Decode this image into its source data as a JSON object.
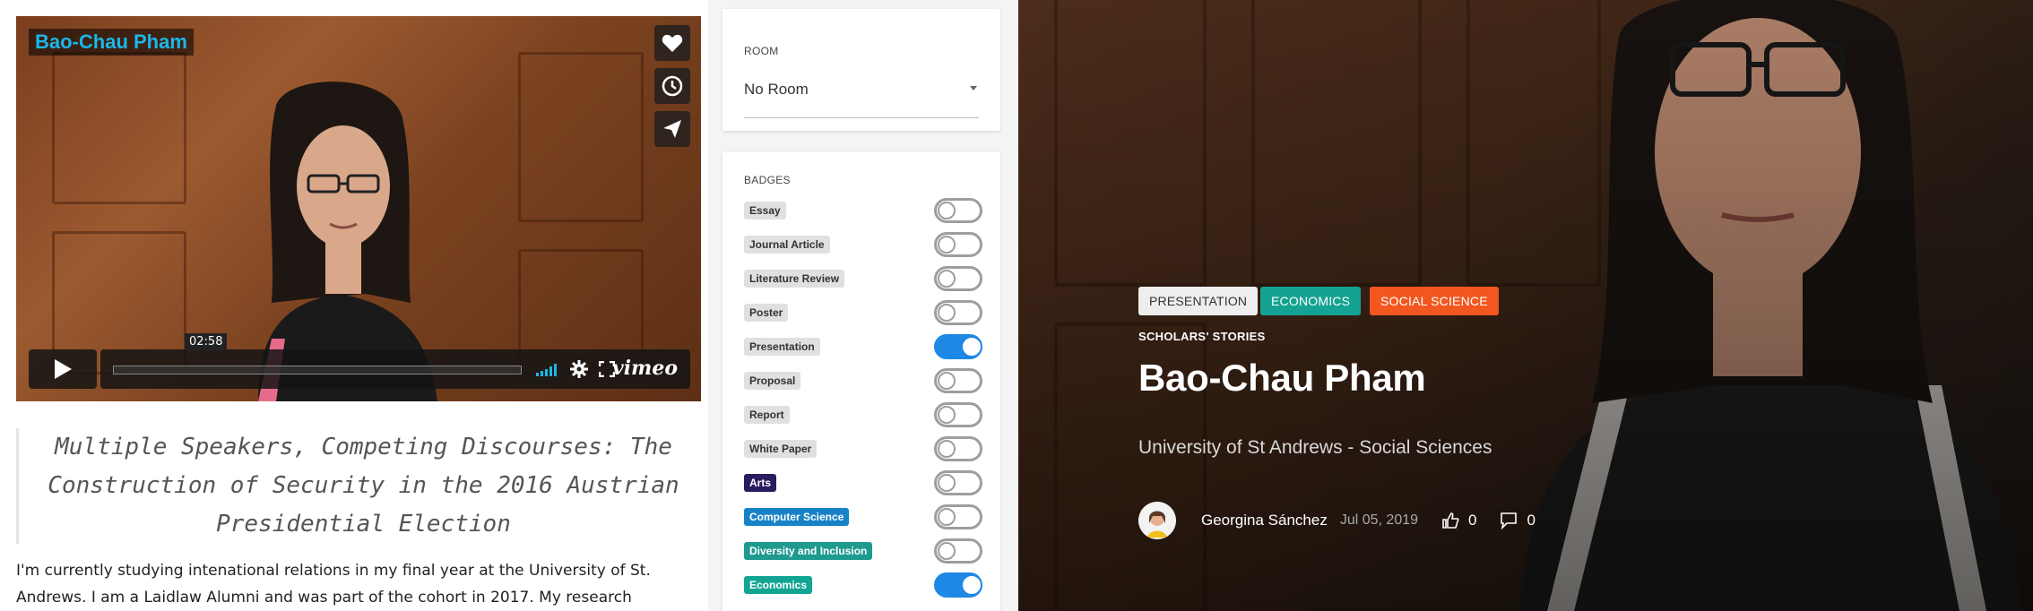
{
  "video": {
    "title": "Bao-Chau Pham",
    "time": "02:58",
    "brand": "vimeo",
    "side_buttons": [
      "heart-icon",
      "clock-icon",
      "send-icon"
    ]
  },
  "article": {
    "title": "Multiple Speakers, Competing Discourses: The Construction of Security in the 2016 Austrian Presidential Election",
    "body": "I'm currently studying intenational relations in my final year at the University of St. Andrews. I am a Laidlaw Alumni and was part of the cohort in 2017. My research"
  },
  "room": {
    "label": "ROOM",
    "value": "No Room"
  },
  "badges": {
    "label": "BADGES",
    "items": [
      {
        "label": "Essay",
        "bg": "#e0e0e0",
        "fg": "#333333",
        "on": false
      },
      {
        "label": "Journal Article",
        "bg": "#e0e0e0",
        "fg": "#333333",
        "on": false
      },
      {
        "label": "Literature Review",
        "bg": "#e0e0e0",
        "fg": "#333333",
        "on": false
      },
      {
        "label": "Poster",
        "bg": "#e0e0e0",
        "fg": "#333333",
        "on": false
      },
      {
        "label": "Presentation",
        "bg": "#e0e0e0",
        "fg": "#333333",
        "on": true
      },
      {
        "label": "Proposal",
        "bg": "#e0e0e0",
        "fg": "#333333",
        "on": false
      },
      {
        "label": "Report",
        "bg": "#e0e0e0",
        "fg": "#333333",
        "on": false
      },
      {
        "label": "White Paper",
        "bg": "#e0e0e0",
        "fg": "#333333",
        "on": false
      },
      {
        "label": "Arts",
        "bg": "#2a1a5e",
        "fg": "#ffffff",
        "on": false
      },
      {
        "label": "Computer Science",
        "bg": "#1783c7",
        "fg": "#ffffff",
        "on": false
      },
      {
        "label": "Diversity and Inclusion",
        "bg": "#1e9a8f",
        "fg": "#ffffff",
        "on": false
      },
      {
        "label": "Economics",
        "bg": "#13a594",
        "fg": "#ffffff",
        "on": true
      }
    ]
  },
  "hero": {
    "chips": [
      {
        "label": "PRESENTATION",
        "bg": "#eeeeee",
        "fg": "#333333"
      },
      {
        "label": "ECONOMICS",
        "bg": "#14a392",
        "fg": "#ffffff"
      },
      {
        "label": "SOCIAL SCIENCE",
        "bg": "#f2571f",
        "fg": "#ffffff"
      }
    ],
    "eyebrow": "SCHOLARS' STORIES",
    "name": "Bao-Chau Pham",
    "subtitle": "University of St Andrews - Social Sciences",
    "author": "Georgina Sánchez",
    "date": "Jul 05, 2019",
    "likes": "0",
    "comments": "0"
  }
}
